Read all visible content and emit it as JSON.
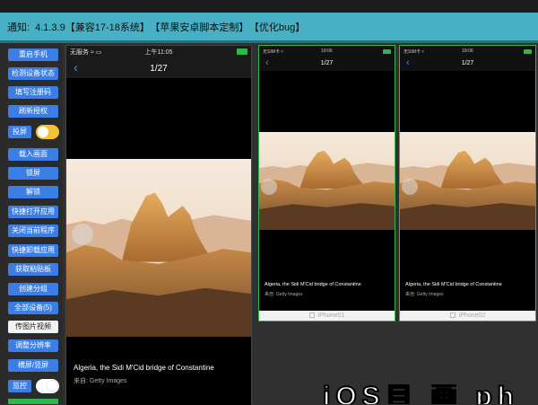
{
  "notice": {
    "prefix": "通知:",
    "version": "4.1.3.9【兼容17-18系统】",
    "custom": "【苹果安卓脚本定制】",
    "fix": "【优化bug】"
  },
  "sidebar": {
    "buttons": [
      "重启手机",
      "检测设备状态",
      "填写注册码",
      "刷新授权"
    ],
    "cast_toggle_label": "投屏",
    "buttons2": [
      "载入画面",
      "锁屏",
      "解锁",
      "快捷打开应用",
      "关闭当前程序",
      "快捷卸载应用",
      "获取粘贴板",
      "创建分组",
      "全部设备(5)",
      "传图片视频",
      "调整分辨率",
      "横屏/竖屏"
    ],
    "monitor_toggle_label": "监控",
    "colors": {
      "button": "#3a7ee6",
      "toggle_on": "#f2c230",
      "toggle_off": "#ffffff"
    }
  },
  "main_phone": {
    "carrier": "无服务 ≈ ▭",
    "time": "上午11:05",
    "page_counter": "1/27",
    "caption": "Algeria, the Sidi M'Cid bridge of Constantine",
    "source": "来自: Getty Images"
  },
  "devices": [
    {
      "status_left": "无SIM卡 ≈",
      "time": "18:06",
      "page_counter": "1/27",
      "caption": "Algeria, the Sidi M'Cid bridge of Constantine",
      "source": "来自: Getty Images",
      "name": "iPhone01"
    },
    {
      "status_left": "无SIM卡 ≈",
      "time": "18:06",
      "page_counter": "1/27",
      "caption": "Algeria, the Sidi M'Cid bridge of Constantine",
      "source": "来自: Getty Images",
      "name": "iPhone02"
    }
  ],
  "overlay_text": "iOS自 画 ph"
}
